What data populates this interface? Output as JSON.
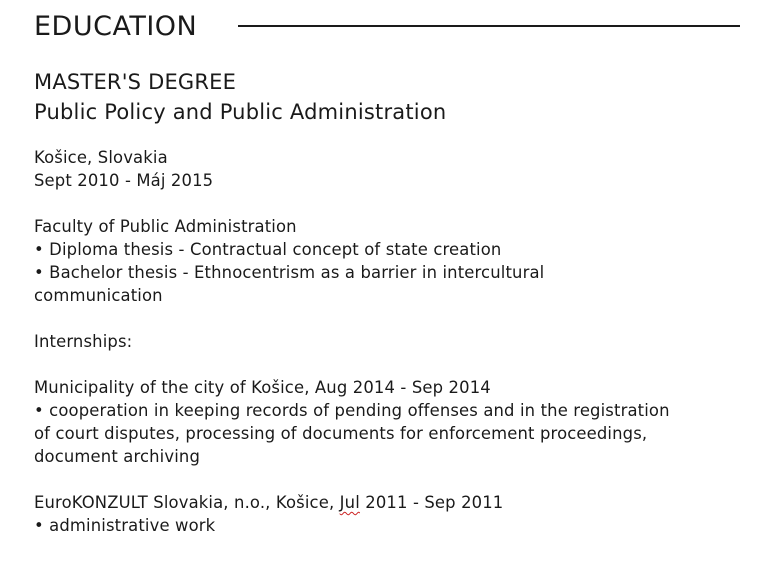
{
  "section": {
    "title": "EDUCATION"
  },
  "degree": {
    "type": "MASTER'S DEGREE",
    "field": "Public Policy and Public Administration"
  },
  "location": "Košice, Slovakia",
  "dates": "Sept 2010 - Máj 2015",
  "faculty": "Faculty of Public Administration",
  "theses": [
    "• Diploma thesis - Contractual concept of state creation",
    "• Bachelor thesis - Ethnocentrism as a barrier in intercultural communication"
  ],
  "internships_label": "Internships:",
  "internship_1": {
    "heading": "Municipality of the city of Košice, Aug 2014 - Sep 2014",
    "detail": "• cooperation in keeping records of pending offenses and in the registration of court disputes, processing of documents for enforcement proceedings, document archiving"
  },
  "internship_2": {
    "heading_before": "EuroKONZULT Slovakia, n.o., Košice, ",
    "heading_month": "Jul",
    "heading_after": " 2011 - Sep 2011",
    "detail": "• administrative work"
  },
  "colors": {
    "text": "#1a1a1a",
    "spellcheck_underline": "#cc2222"
  }
}
